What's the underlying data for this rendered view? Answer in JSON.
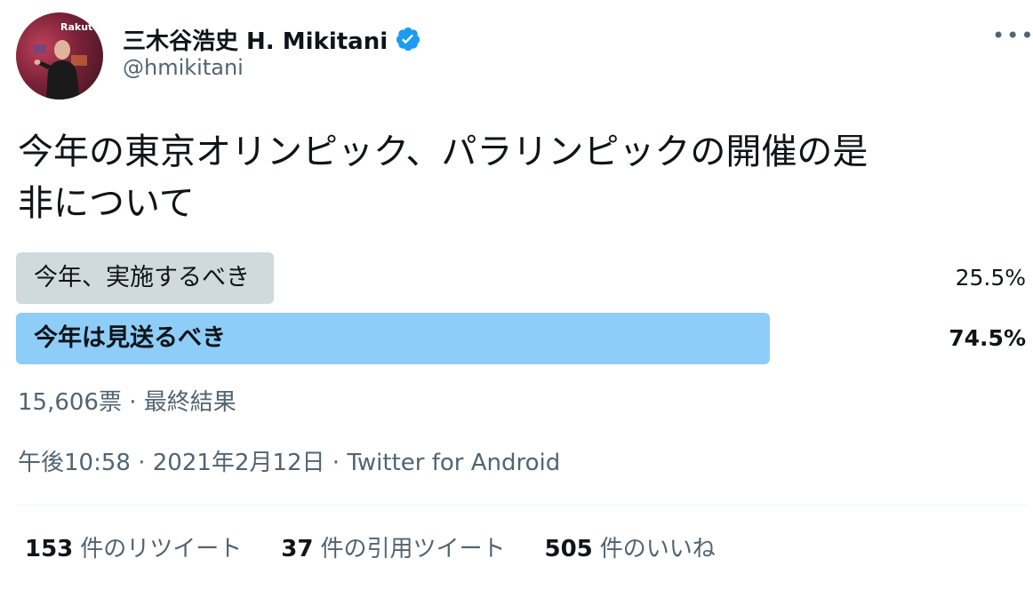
{
  "author": {
    "display_name": "三木谷浩史 H. Mikitani",
    "handle": "@hmikitani",
    "avatar_text": "Rakute",
    "verified": true
  },
  "more_icon": "•••",
  "tweet": {
    "line1": "今年の東京オリンピック、パラリンピックの開催の是",
    "line2": "非について"
  },
  "poll": {
    "options": [
      {
        "label": "今年、実施するべき",
        "percent_text": "25.5%",
        "share": 0.255,
        "winner": false
      },
      {
        "label": "今年は見送るべき",
        "percent_text": "74.5%",
        "share": 0.745,
        "winner": true
      }
    ],
    "meta": "15,606票 · 最終結果"
  },
  "timestamp": {
    "time": "午後10:58",
    "sep1": " · ",
    "date": "2021年2月12日",
    "sep2": " · ",
    "source": "Twitter for Android"
  },
  "stats": {
    "retweets": {
      "num": "153",
      "unit": "件のリツイート"
    },
    "quotes": {
      "num": "37",
      "unit": "件の引用ツイート"
    },
    "likes": {
      "num": "505",
      "unit": "件のいいね"
    }
  },
  "colors": {
    "winner_bar": "#8ecdf8",
    "other_bar": "#cfd9de",
    "secondary_text": "#536471",
    "verified_badge": "#1d9bf0"
  }
}
